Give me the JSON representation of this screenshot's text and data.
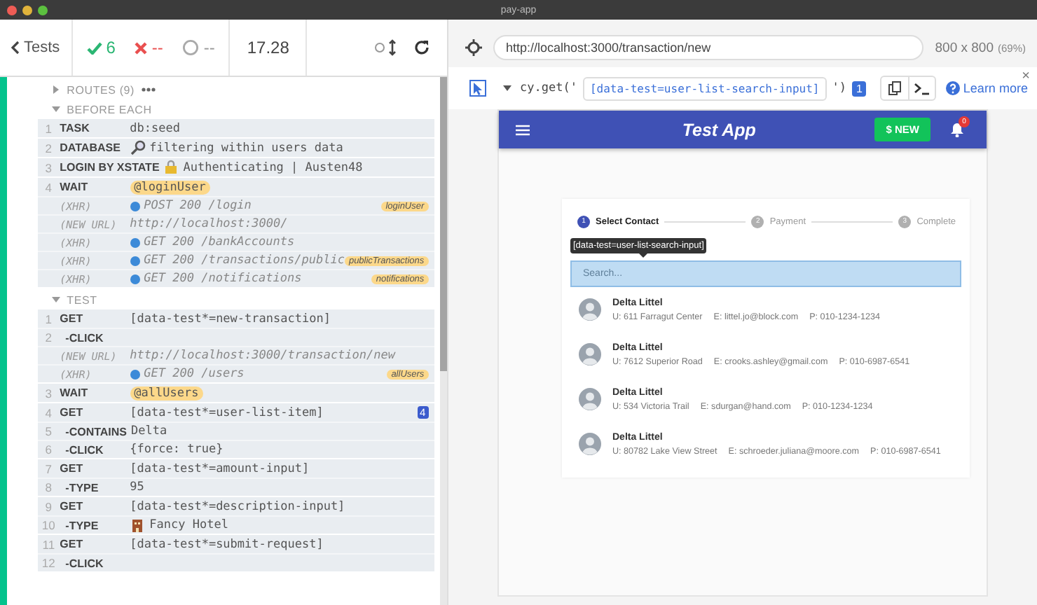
{
  "window": {
    "title": "pay-app"
  },
  "reporter": {
    "back_label": "Tests",
    "passed": "6",
    "failed": "--",
    "pending": "--",
    "duration": "17.28"
  },
  "sections": [
    {
      "title": "ROUTES (9)",
      "expanded": false,
      "more": true
    },
    {
      "title": "BEFORE EACH",
      "expanded": true,
      "groups": [
        [
          {
            "number": "1",
            "command": "TASK",
            "message": "db:seed",
            "kind": "command"
          }
        ],
        [
          {
            "number": "2",
            "command": "DATABASE",
            "message": "filtering within users data",
            "kind": "command",
            "symbol": {
              "kind": "magnifier"
            }
          }
        ],
        [
          {
            "number": "3",
            "command": "LOGIN BY XSTATE",
            "message": "Authenticating | Austen48",
            "kind": "command",
            "symbol": {
              "kind": "lock"
            }
          }
        ],
        [
          {
            "number": "4",
            "command": "WAIT",
            "message": "@loginUser",
            "kind": "command",
            "pill": true
          },
          {
            "command": "(XHR)",
            "message": "POST 200 /login",
            "kind": "event",
            "dot": true,
            "alias": "loginUser"
          },
          {
            "command": "(NEW URL)",
            "message": "http://localhost:3000/",
            "kind": "event"
          },
          {
            "command": "(XHR)",
            "message": "GET 200 /bankAccounts",
            "kind": "event",
            "dot": true
          },
          {
            "command": "(XHR)",
            "message": "GET 200 /transactions/public",
            "kind": "event",
            "dot": true,
            "alias": "publicTransactions"
          },
          {
            "command": "(XHR)",
            "message": "GET 200 /notifications",
            "kind": "event",
            "dot": true,
            "alias": "notifications"
          }
        ]
      ]
    },
    {
      "title": "TEST",
      "expanded": true,
      "groups": [
        [
          {
            "number": "1",
            "command": "GET",
            "message": "[data-test*=new-transaction]",
            "kind": "command"
          },
          {
            "number": "2",
            "command": "-CLICK",
            "kind": "child"
          },
          {
            "command": "(NEW URL)",
            "message": "http://localhost:3000/transaction/new",
            "kind": "event"
          },
          {
            "command": "(XHR)",
            "message": "GET 200 /users",
            "kind": "event",
            "dot": true,
            "alias": "allUsers"
          }
        ],
        [
          {
            "number": "3",
            "command": "WAIT",
            "message": "@allUsers",
            "kind": "command",
            "pill": true
          }
        ],
        [
          {
            "number": "4",
            "command": "GET",
            "message": "[data-test*=user-list-item]",
            "kind": "command",
            "count": "4"
          },
          {
            "number": "5",
            "command": "-CONTAINS",
            "message": "Delta",
            "kind": "child"
          },
          {
            "number": "6",
            "command": "-CLICK",
            "message": "{force: true}",
            "kind": "child"
          }
        ],
        [
          {
            "number": "7",
            "command": "GET",
            "message": "[data-test*=amount-input]",
            "kind": "command"
          },
          {
            "number": "8",
            "command": "-TYPE",
            "message": "95",
            "kind": "child"
          }
        ],
        [
          {
            "number": "9",
            "command": "GET",
            "message": "[data-test*=description-input]",
            "kind": "command"
          },
          {
            "number": "10",
            "command": "-TYPE",
            "message": "Fancy Hotel",
            "kind": "child",
            "symbol": {
              "kind": "hotel"
            }
          }
        ],
        [
          {
            "number": "11",
            "command": "GET",
            "message": "[data-test*=submit-request]",
            "kind": "command"
          },
          {
            "number": "12",
            "command": "-CLICK",
            "kind": "child"
          }
        ]
      ]
    }
  ],
  "url_bar": {
    "url": "http://localhost:3000/transaction/new",
    "size": "800 x 800",
    "scale": "(69%)"
  },
  "selector_playground": {
    "prefix": "cy.get('",
    "selector": "[data-test=user-list-search-input]",
    "suffix": "')",
    "matches": "1",
    "help": "Learn more",
    "close": "×"
  },
  "app": {
    "title": "Test App",
    "new_button": "$ NEW",
    "notifications": "0",
    "steps": [
      {
        "number": "1",
        "label": "Select Contact",
        "selected": true
      },
      {
        "number": "2",
        "label": "Payment",
        "selected": false
      },
      {
        "number": "3",
        "label": "Complete",
        "selected": false
      }
    ],
    "tooltip": "[data-test=user-list-search-input]",
    "search": {
      "placeholder": "Search...",
      "highlighted": true
    },
    "contacts": [
      {
        "name": "Delta Littel",
        "address": "U: 611 Farragut Center",
        "email": "E: littel.jo@block.com",
        "phone": "P: 010-1234-1234"
      },
      {
        "name": "Delta Littel",
        "address": "U: 7612 Superior Road",
        "email": "E: crooks.ashley@gmail.com",
        "phone": "P: 010-6987-6541"
      },
      {
        "name": "Delta Littel",
        "address": "U: 534 Victoria Trail",
        "email": "E: sdurgan@hand.com",
        "phone": "P: 010-1234-1234"
      },
      {
        "name": "Delta Littel",
        "address": "U: 80782 Lake View Street",
        "email": "E: schroeder.juliana@moore.com",
        "phone": "P: 010-6987-6541"
      }
    ]
  }
}
